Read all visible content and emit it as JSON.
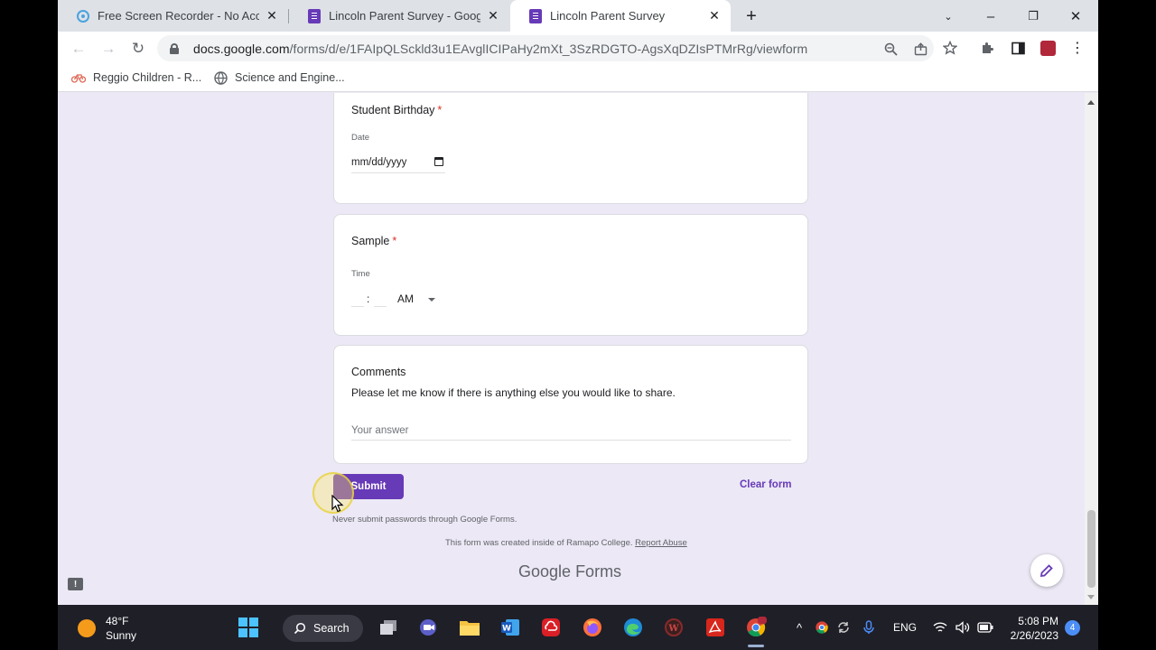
{
  "browser": {
    "tabs": [
      {
        "title": "Free Screen Recorder - No Accou",
        "icon": "screen-recorder-icon"
      },
      {
        "title": "Lincoln Parent Survey - Google F",
        "icon": "google-forms-icon"
      },
      {
        "title": "Lincoln Parent Survey",
        "icon": "google-forms-icon",
        "active": true
      }
    ],
    "url_domain": "docs.google.com",
    "url_path": "/forms/d/e/1FAIpQLSckld3u1EAvglICIPaHy2mXt_3SzRDGTO-AgsXqDZIsPTMrRg/viewform",
    "bookmarks": [
      {
        "label": "Reggio Children - R...",
        "icon": "bicycle-icon"
      },
      {
        "label": "Science and Engine...",
        "icon": "globe-icon"
      }
    ]
  },
  "form": {
    "questions": [
      {
        "title": "Student Birthday",
        "required": "*",
        "sublabel": "Date",
        "placeholder": "mm/dd/yyyy"
      },
      {
        "title": "Sample",
        "required": "*",
        "sublabel": "Time",
        "time_separator": ":",
        "period": "AM"
      },
      {
        "title": "Comments",
        "description": "Please let me know if there is anything else you would like to share.",
        "placeholder": "Your answer"
      }
    ],
    "submit_label": "Submit",
    "clear_label": "Clear form",
    "password_note": "Never submit passwords through Google Forms.",
    "footer_note": "This form was created inside of Ramapo College.",
    "report_link": "Report Abuse",
    "brand_google": "Google",
    "brand_forms": "Forms"
  },
  "taskbar": {
    "temperature": "48°F",
    "weather": "Sunny",
    "search_label": "Search",
    "language": "ENG",
    "time": "5:08 PM",
    "date": "2/26/2023",
    "notification_count": "4"
  },
  "colors": {
    "accent": "#673ab7",
    "required": "#d93025",
    "page_bg": "#ece8f5"
  }
}
